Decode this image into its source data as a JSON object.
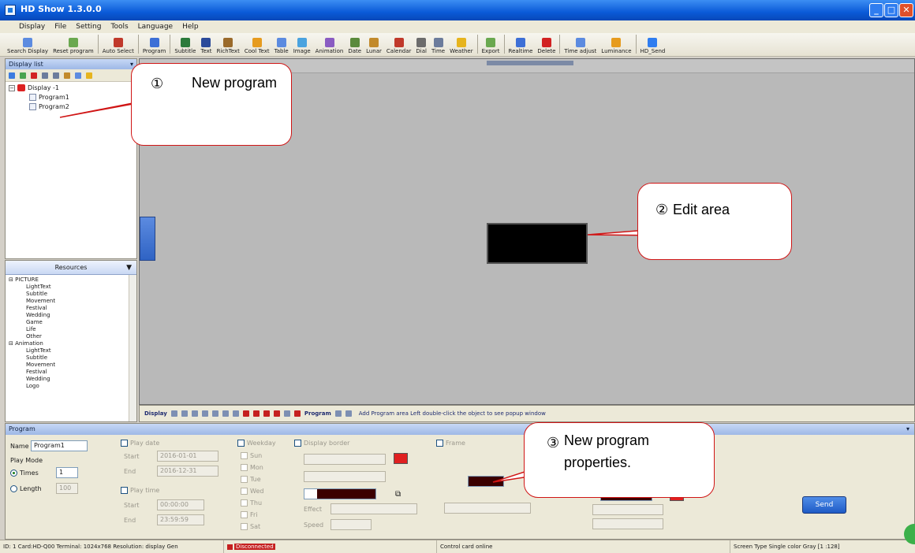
{
  "window": {
    "title": "HD Show 1.3.0.0",
    "buttons": {
      "minimize": "_",
      "maximize": "□",
      "close": "✕"
    }
  },
  "menu": {
    "items": [
      "Display",
      "File",
      "Setting",
      "Tools",
      "Language",
      "Help"
    ]
  },
  "toolbar": {
    "buttons": [
      {
        "label": "Search Display",
        "icon": "search-display-icon",
        "color": "#5c8be0"
      },
      {
        "label": "Reset program",
        "icon": "reset-icon",
        "color": "#6aa84f"
      },
      {
        "label": "Auto Select",
        "icon": "auto-select-icon",
        "color": "#c0392b"
      },
      {
        "label": "Program",
        "icon": "program-icon",
        "color": "#3d6fd6"
      },
      {
        "label": "Subtitle",
        "icon": "subtitle-icon",
        "color": "#2b7a3b"
      },
      {
        "label": "Text",
        "icon": "text-icon",
        "color": "#2b4a9a"
      },
      {
        "label": "RichText",
        "icon": "richtext-icon",
        "color": "#9a6a2b"
      },
      {
        "label": "Cool Text",
        "icon": "cool-text-icon",
        "color": "#e69b1e"
      },
      {
        "label": "Table",
        "icon": "table-icon",
        "color": "#5c8be0"
      },
      {
        "label": "Image",
        "icon": "image-icon",
        "color": "#4aa3df"
      },
      {
        "label": "Animation",
        "icon": "animation-icon",
        "color": "#8a5cc2"
      },
      {
        "label": "Date",
        "icon": "date-icon",
        "color": "#5a8a3c"
      },
      {
        "label": "Lunar",
        "icon": "lunar-icon",
        "color": "#c28a2b"
      },
      {
        "label": "Calendar",
        "icon": "calendar-icon",
        "color": "#c0392b"
      },
      {
        "label": "Dial",
        "icon": "dial-icon",
        "color": "#6c6c6c"
      },
      {
        "label": "Time",
        "icon": "time-icon",
        "color": "#6c7c9c"
      },
      {
        "label": "Weather",
        "icon": "weather-icon",
        "color": "#e6b41e"
      },
      {
        "label": "Export",
        "icon": "export-icon",
        "color": "#6aa84f"
      },
      {
        "label": "Realtime",
        "icon": "realtime-icon",
        "color": "#3d6fd6"
      },
      {
        "label": "Delete",
        "icon": "delete-icon",
        "color": "#d22222"
      },
      {
        "label": "Time adjust",
        "icon": "time-adjust-icon",
        "color": "#5c8be0"
      },
      {
        "label": "Luminance",
        "icon": "luminance-icon",
        "color": "#e69b1e"
      },
      {
        "label": "HD_Send",
        "icon": "send-icon",
        "color": "#2f7df0"
      }
    ]
  },
  "display_list": {
    "title": "Display list",
    "tree": {
      "display": "Display -1",
      "programs": [
        "Program1",
        "Program2"
      ]
    }
  },
  "resources": {
    "title": "Resources",
    "groups": [
      {
        "name": "PICTURE",
        "items": [
          "LightText",
          "Subtitle",
          "Movement",
          "Festival",
          "Wedding",
          "Game",
          "Life",
          "Other"
        ]
      },
      {
        "name": "Animation",
        "items": [
          "LightText",
          "Subtitle",
          "Movement",
          "Festival",
          "Wedding",
          "Logo"
        ]
      }
    ]
  },
  "edit_toolbar": {
    "display_label": "Display",
    "program_label": "Program",
    "status": "Add Program area   Left double-click the object to see popup window"
  },
  "properties": {
    "title": "Program",
    "name_label": "Name",
    "name_value": "Program1",
    "play_mode_label": "Play Mode",
    "times_label": "Times",
    "times_value": "1",
    "length_label": "Length",
    "length_value": "100",
    "play_date_label": "Play date",
    "start_label": "Start",
    "end_label": "End",
    "start_date": "2016-01-01",
    "end_date": "2016-12-31",
    "play_time_label": "Play time",
    "start_time": "00:00:00",
    "end_time": "23:59:59",
    "weekday_label": "Weekday",
    "days": [
      "Sun",
      "Mon",
      "Tue",
      "Wed",
      "Thu",
      "Fri",
      "Sat"
    ],
    "border_label": "Display border",
    "border_effect_label": "Effect",
    "border_speed_label": "Speed",
    "frame_label": "Frame",
    "send_label": "Send",
    "colors": {
      "accent_red": "#e02020",
      "dark_red": "#3b0000"
    }
  },
  "status_bar": {
    "left": "ID: 1  Card:HD-Q00  Terminal: 1024x768  Resolution: display  Gen",
    "disconnected": "Disconnected",
    "center": "Control card online",
    "right": "Screen Type  Single color  Gray  [1 :128]"
  },
  "callouts": [
    {
      "num": "①",
      "text": "New program"
    },
    {
      "num": "②",
      "text": "Edit area"
    },
    {
      "num": "③",
      "text": "New program properties."
    }
  ]
}
